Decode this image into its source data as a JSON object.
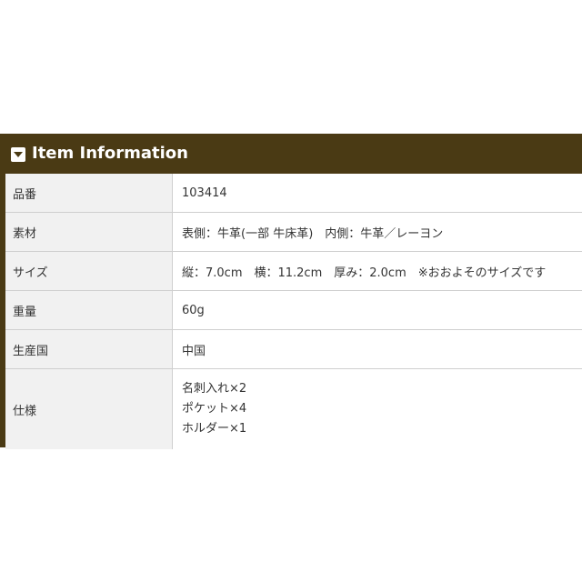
{
  "panel": {
    "title": "Item Information",
    "icon": "dropdown-toggle-icon",
    "colors": {
      "header_bg": "#4a3a14",
      "label_bg": "#f1f1f1",
      "border": "#cfcfcf",
      "text": "#333333"
    }
  },
  "rows": [
    {
      "label": "品番",
      "value": "103414"
    },
    {
      "label": "素材",
      "value": "表側：牛革(一部 牛床革)　内側：牛革／レーヨン"
    },
    {
      "label": "サイズ",
      "value": "縦：7.0cm　横：11.2cm　厚み：2.0cm　※おおよそのサイズです"
    },
    {
      "label": "重量",
      "value": "60g"
    },
    {
      "label": "生産国",
      "value": "中国"
    },
    {
      "label": "仕様",
      "lines": [
        "名刺入れ×2",
        "ポケット×4",
        "ホルダー×1"
      ]
    }
  ]
}
